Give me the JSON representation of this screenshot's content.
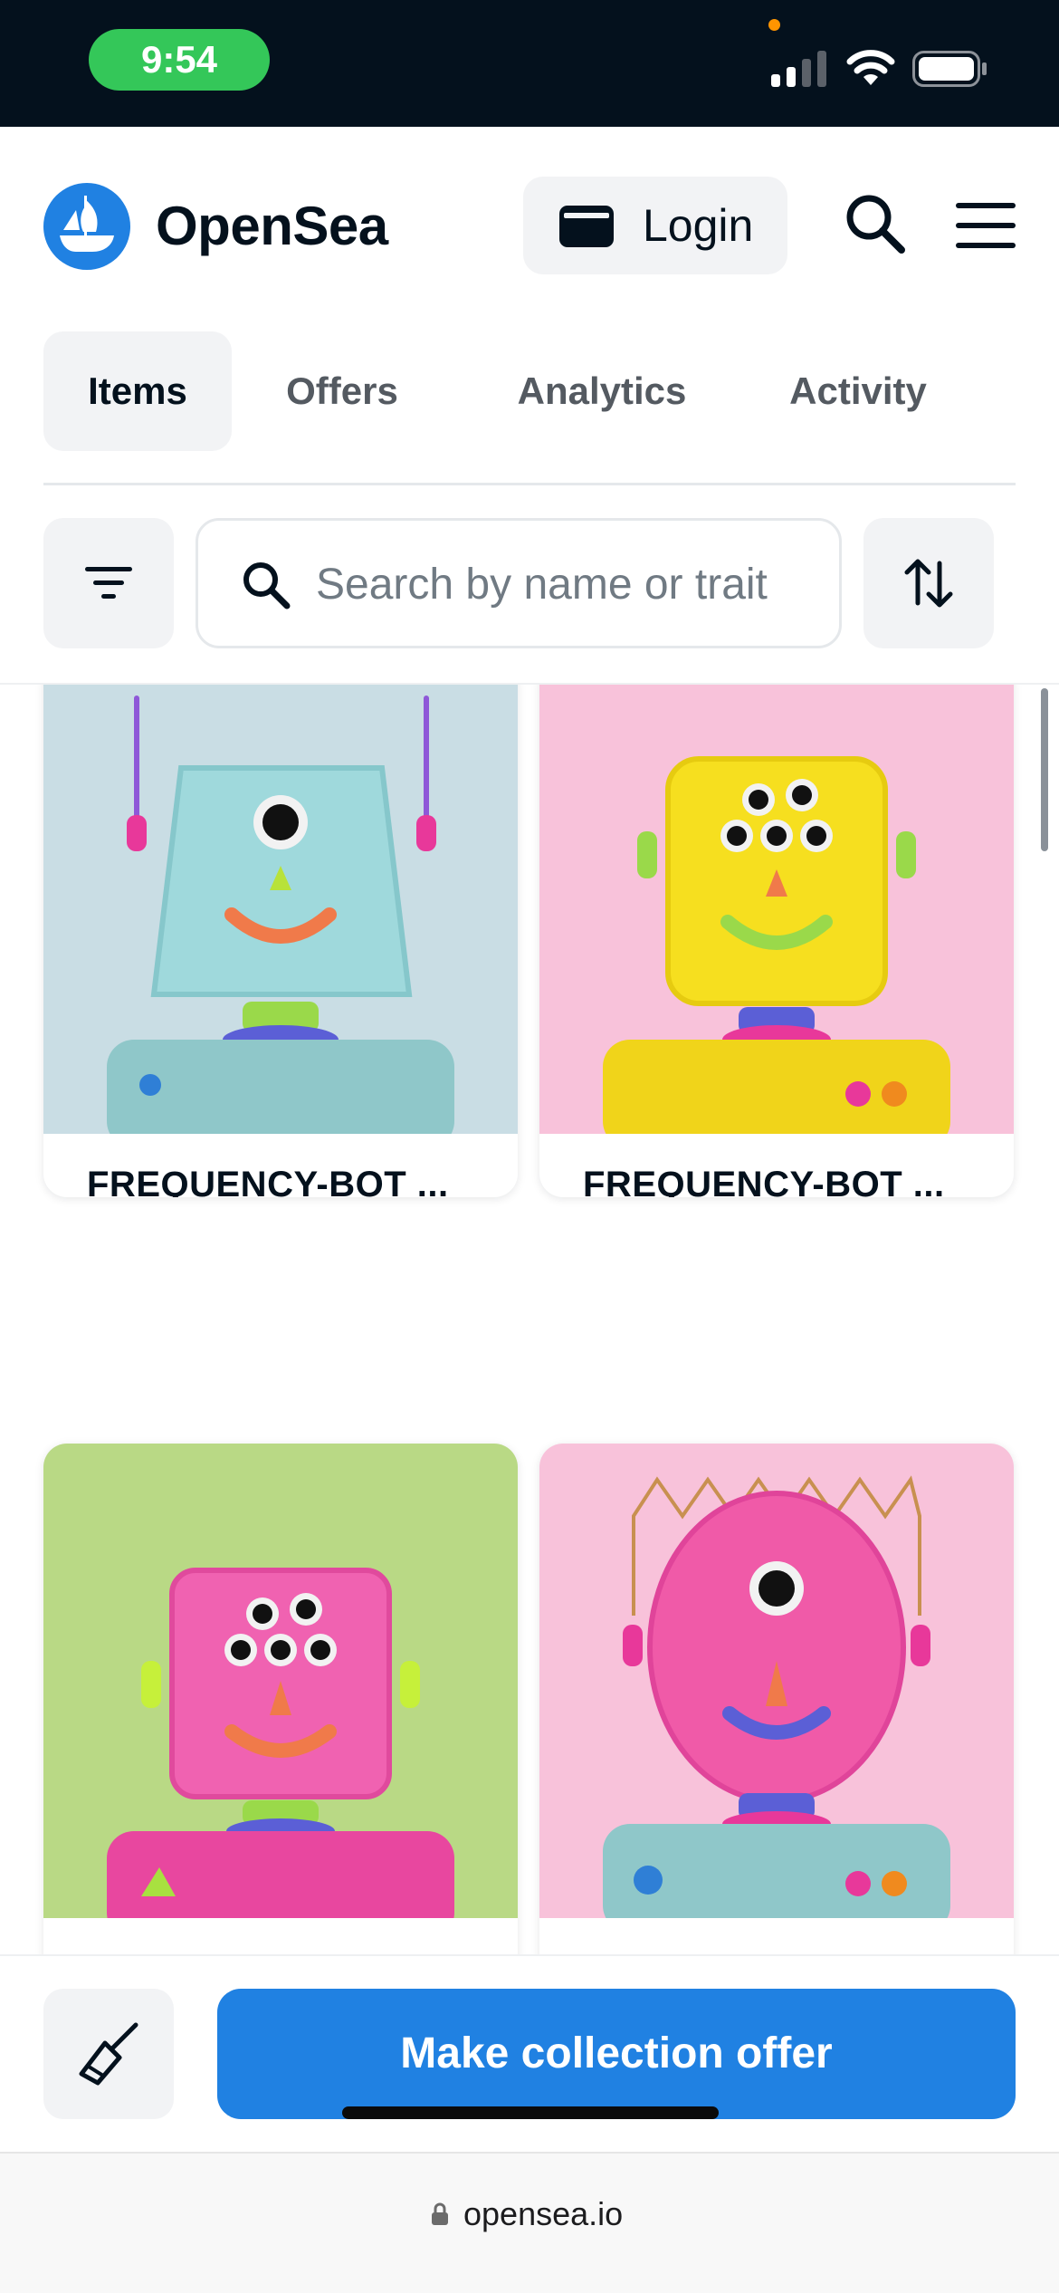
{
  "status_bar": {
    "time": "9:54",
    "icons": [
      "signal-icon",
      "wifi-icon",
      "battery-icon"
    ]
  },
  "header": {
    "brand": "OpenSea",
    "login_label": "Login",
    "icons": [
      "opensea-logo-icon",
      "wallet-icon",
      "search-icon",
      "menu-icon"
    ]
  },
  "tabs": [
    {
      "label": "Items",
      "active": true
    },
    {
      "label": "Offers",
      "active": false
    },
    {
      "label": "Analytics",
      "active": false
    },
    {
      "label": "Activity",
      "active": false
    }
  ],
  "search": {
    "placeholder": "Search by name or trait",
    "value": ""
  },
  "items": [
    {
      "name": "FREQUENCY-BOT ...",
      "background": "#c9dde4",
      "head_color": "#9fd9dc"
    },
    {
      "name": "FREQUENCY-BOT ...",
      "background": "#f8c2da",
      "head_color": "#f6df1f"
    },
    {
      "name": "",
      "background": "#b9d985",
      "head_color": "#f062b1"
    },
    {
      "name": "",
      "background": "#f8c2da",
      "head_color": "#f05aa8"
    }
  ],
  "actions": {
    "offer_label": "Make collection offer"
  },
  "browser": {
    "url": "opensea.io"
  },
  "colors": {
    "accent": "#2081e2",
    "status_bar_bg": "#04111d",
    "time_pill": "#34c759"
  }
}
